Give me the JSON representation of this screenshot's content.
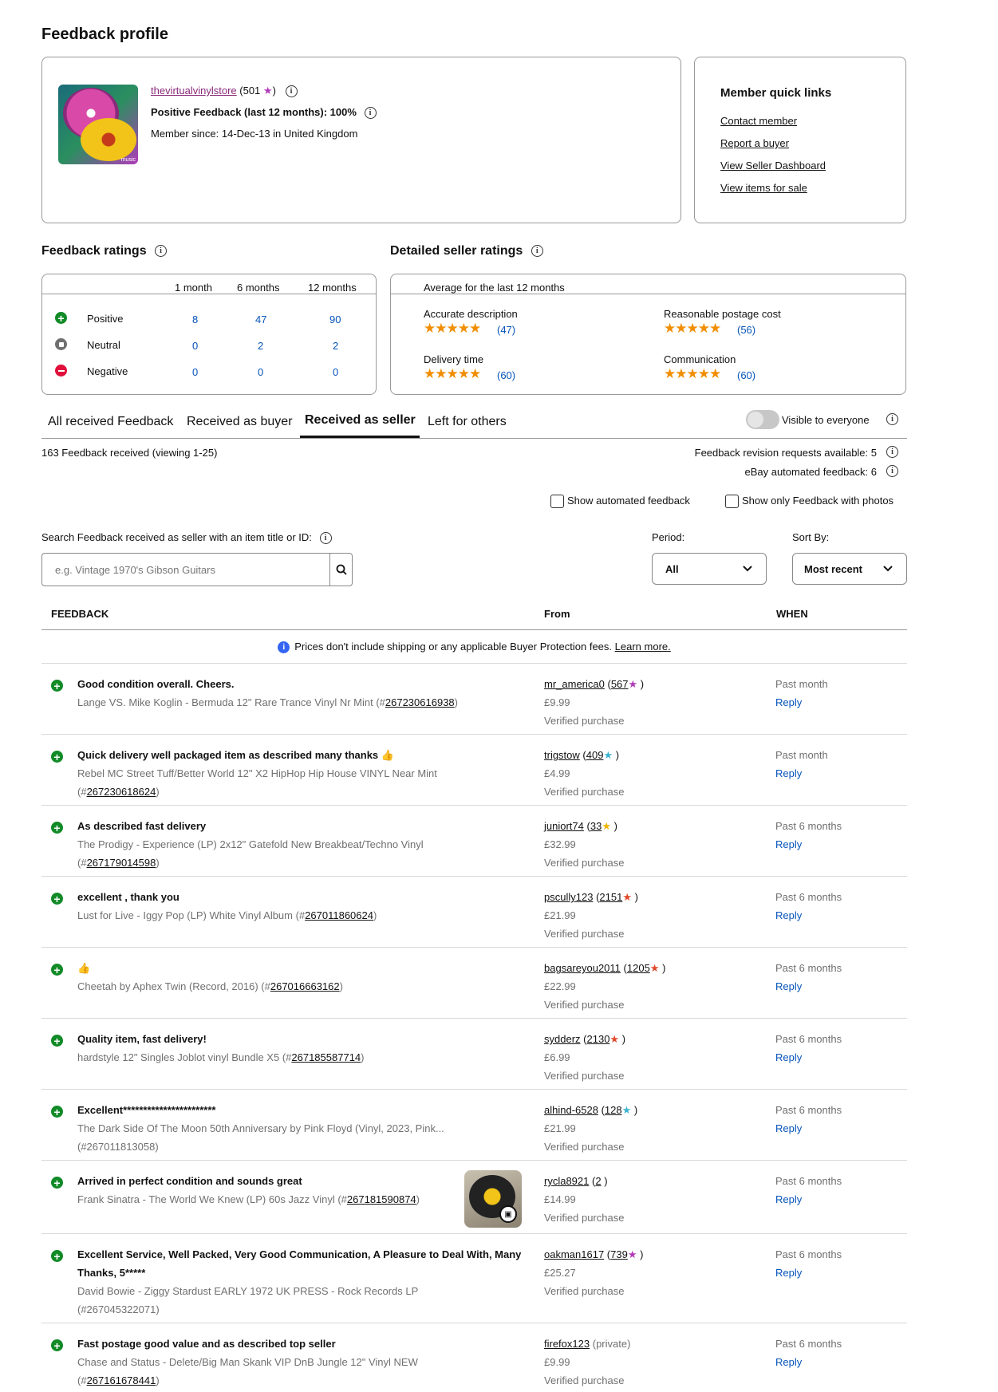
{
  "page_title": "Feedback profile",
  "profile": {
    "username": "thevirtualvinylstore",
    "score_open": " (501 ",
    "score_close": ")",
    "positive_feedback": "Positive Feedback (last 12 months): 100%",
    "member_since": "Member since: 14-Dec-13 in United Kingdom",
    "avatar_caption": "music"
  },
  "quick_links": {
    "title": "Member quick links",
    "links": [
      "Contact member",
      "Report a buyer",
      "View Seller Dashboard",
      "View items for sale"
    ]
  },
  "ratings": {
    "title": "Feedback ratings",
    "cols": [
      "1 month",
      "6 months",
      "12 months"
    ],
    "rows": [
      {
        "label": "Positive",
        "v": [
          "8",
          "47",
          "90"
        ]
      },
      {
        "label": "Neutral",
        "v": [
          "0",
          "2",
          "2"
        ]
      },
      {
        "label": "Negative",
        "v": [
          "0",
          "0",
          "0"
        ]
      }
    ]
  },
  "dsr": {
    "title": "Detailed seller ratings",
    "subtitle": "Average for the last 12 months",
    "items": [
      {
        "label": "Accurate description",
        "count": "(47)",
        "stars": 5
      },
      {
        "label": "Reasonable postage cost",
        "count": "(56)",
        "stars": 5
      },
      {
        "label": "Delivery time",
        "count": "(60)",
        "stars": 5
      },
      {
        "label": "Communication",
        "count": "(60)",
        "stars": 5
      }
    ]
  },
  "tabs": [
    "All received Feedback",
    "Received as buyer",
    "Received as seller",
    "Left for others"
  ],
  "visible_label": "Visible to everyone",
  "count_text": "163 Feedback received (viewing 1-25)",
  "revision_text": "Feedback revision requests available: 5",
  "automated_text": "eBay automated feedback: 6",
  "show_automated": "Show automated feedback",
  "show_photos": "Show only Feedback with photos",
  "search": {
    "label": "Search Feedback received as seller with an item title or ID:",
    "placeholder": "e.g. Vintage 1970's Gibson Guitars"
  },
  "period": {
    "label": "Period:",
    "value": "All"
  },
  "sort": {
    "label": "Sort By:",
    "value": "Most recent"
  },
  "table_headers": {
    "feedback": "FEEDBACK",
    "from": "From",
    "when": "WHEN"
  },
  "notice": {
    "text": "Prices don't include shipping or any applicable Buyer Protection fees.",
    "link": "Learn more."
  },
  "verified": "Verified purchase",
  "reply": "Reply",
  "rows": [
    {
      "title": "Good condition overall. Cheers.",
      "item": "Lange VS. Mike Koglin - Bermuda 12\" Rare Trance Vinyl Nr Mint (#",
      "item_id": "267230616938",
      "item_end": ")",
      "user": "mr_america0",
      "score": "567",
      "star_color": "#b03ab8",
      "price": "£9.99",
      "when": "Past month"
    },
    {
      "title": "Quick delivery well packaged item as described many thanks 👍",
      "item": "Rebel MC Street Tuff/Better World 12\" X2 HipHop Hip House VINYL Near Mint (#",
      "item_id": "267230618624",
      "item_end": ")",
      "user": "trigstow",
      "score": "409",
      "star_color": "#3ab4d0",
      "price": "£4.99",
      "when": "Past month"
    },
    {
      "title": "As described fast delivery",
      "item": "The Prodigy - Experience (LP) 2x12\" Gatefold New Breakbeat/Techno Vinyl (#",
      "item_id": "267179014598",
      "item_end": ")",
      "user": "juniort74",
      "score": "33",
      "star_color": "#f1b400",
      "price": "£32.99",
      "when": "Past 6 months"
    },
    {
      "title": "excellent , thank you",
      "item": "Lust for Live - Iggy Pop (LP) White Vinyl Album (#",
      "item_id": "267011860624",
      "item_end": ")",
      "user": "pscully123",
      "score": "2151",
      "star_color": "#e0492a",
      "price": "£21.99",
      "when": "Past 6 months"
    },
    {
      "title": "👍",
      "item": "Cheetah by Aphex Twin (Record, 2016) (#",
      "item_id": "267016663162",
      "item_end": ")",
      "user": "bagsareyou2011",
      "score": "1205",
      "star_color": "#e0492a",
      "price": "£22.99",
      "when": "Past 6 months"
    },
    {
      "title": "Quality item, fast delivery!",
      "item": "hardstyle 12\" Singles Joblot vinyl Bundle X5 (#",
      "item_id": "267185587714",
      "item_end": ")",
      "user": "sydderz",
      "score": "2130",
      "star_color": "#e0492a",
      "price": "£6.99",
      "when": "Past 6 months"
    },
    {
      "title": "Excellent***********************",
      "item": "The Dark Side Of The Moon 50th Anniversary by Pink Floyd (Vinyl, 2023, Pink... (#267011813058)",
      "item_id": "",
      "item_end": "",
      "user": "alhind-6528",
      "score": "128",
      "star_color": "#3ab4d0",
      "price": "£21.99",
      "when": "Past 6 months"
    },
    {
      "title": "Arrived in perfect condition and sounds great",
      "item": "Frank Sinatra - The World We Knew (LP) 60s Jazz Vinyl (#",
      "item_id": "267181590874",
      "item_end": ")",
      "user": "rycla8921",
      "score": "2",
      "star_color": "",
      "price": "£14.99",
      "when": "Past 6 months"
    },
    {
      "title": "Excellent Service, Well Packed, Very Good Communication, A Pleasure to Deal With, Many Thanks, 5*****",
      "item": "David Bowie - Ziggy Stardust EARLY 1972 UK PRESS - Rock Records LP (#267045322071)",
      "item_id": "",
      "item_end": "",
      "user": "oakman1617",
      "score": "739",
      "star_color": "#b03ab8",
      "price": "£25.27",
      "when": "Past 6 months"
    },
    {
      "title": "Fast postage good value and as described top seller",
      "item": "Chase and Status - Delete/Big Man Skank VIP DnB Jungle 12\" Vinyl NEW (#",
      "item_id": "267161678441",
      "item_end": ")",
      "user": "firefox123",
      "score": "private",
      "star_color": "",
      "price": "£9.99",
      "when": "Past 6 months"
    }
  ]
}
